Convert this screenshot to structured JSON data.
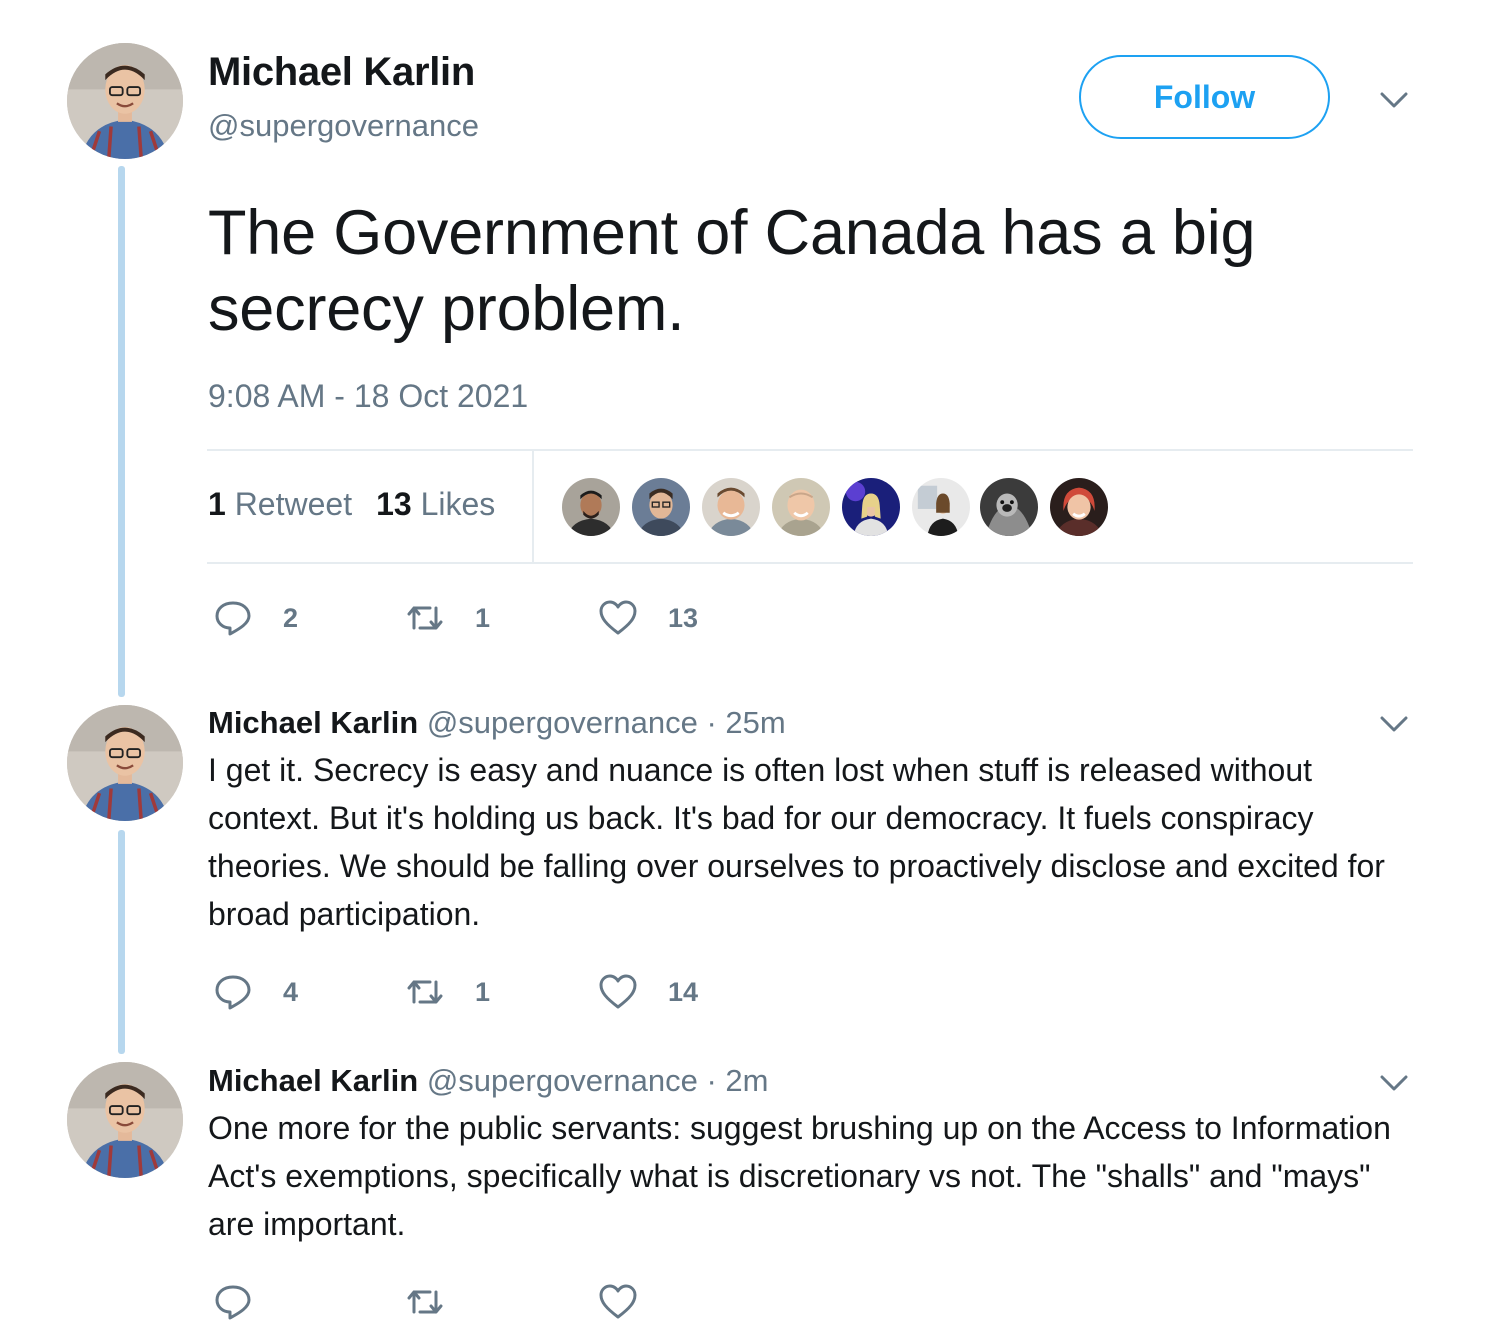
{
  "main_tweet": {
    "author_name": "Michael Karlin",
    "author_handle": "@supergovernance",
    "follow_label": "Follow",
    "text": "The Government of Canada has a big secrecy problem.",
    "timestamp": "9:08 AM - 18 Oct 2021",
    "retweet_count": "1",
    "retweet_label": "Retweet",
    "like_count": "13",
    "like_label": "Likes",
    "actions": {
      "reply": "2",
      "retweet": "1",
      "like": "13"
    }
  },
  "replies": [
    {
      "author_name": "Michael Karlin",
      "author_handle": "@supergovernance",
      "time": "· 25m",
      "text": "I get it. Secrecy is easy and nuance is often lost when stuff is released without context. But it's holding us back. It's bad for our democracy. It fuels conspiracy theories. We should be falling over ourselves to proactively disclose and excited for broad participation.",
      "actions": {
        "reply": "4",
        "retweet": "1",
        "like": "14"
      }
    },
    {
      "author_name": "Michael Karlin",
      "author_handle": "@supergovernance",
      "time": "· 2m",
      "text": "One more for the public servants: suggest brushing up on the Access to Information Act's exemptions, specifically what is discretionary vs not. The \"shalls\" and \"mays\" are important.",
      "actions": {
        "reply": "",
        "retweet": "",
        "like": ""
      }
    }
  ],
  "icons": {
    "reply": "speech-bubble-icon",
    "retweet": "retweet-arrows-icon",
    "like": "heart-icon",
    "menu": "chevron-down-icon"
  },
  "colors": {
    "accent": "#1da1f2",
    "secondary_text": "#657786",
    "thread_line": "#b7d7ee",
    "divider": "#e6ecf0"
  }
}
